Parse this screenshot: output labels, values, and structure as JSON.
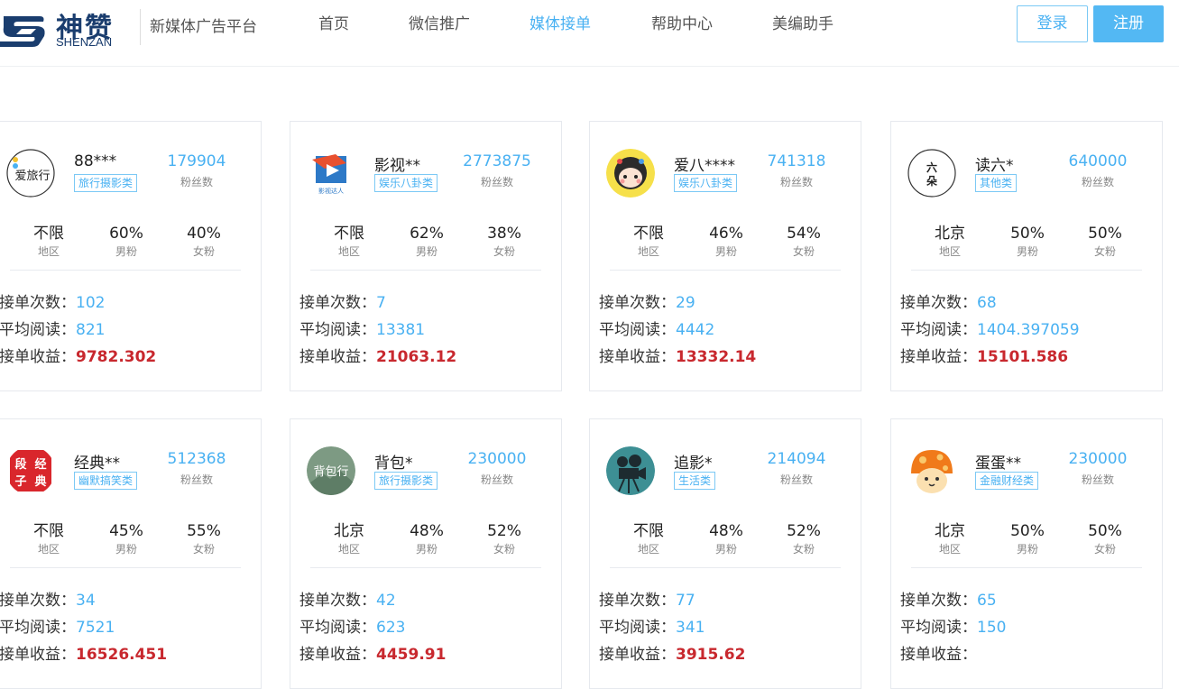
{
  "header": {
    "logo_cn": "神赞",
    "logo_en": "SHENZAN",
    "platform_name": "新媒体广告平台",
    "nav": [
      "首页",
      "微信推广",
      "媒体接单",
      "帮助中心",
      "美编助手"
    ],
    "active_nav": "媒体接单",
    "login_label": "登录",
    "register_label": "注册"
  },
  "labels": {
    "fans": "粉丝数",
    "region": "地区",
    "male": "男粉",
    "female": "女粉",
    "orders": "接单次数：",
    "avg_read": "平均阅读：",
    "income": "接单收益："
  },
  "colors": {
    "accent": "#49b1f2",
    "income_red": "#c8282e",
    "brand_navy": "#1a3d6e"
  },
  "cards": [
    {
      "name": "88***",
      "category": "旅行摄影类",
      "fans": "179904",
      "region": "不限",
      "male": "60%",
      "female": "40%",
      "orders": "102",
      "avg_read": "821",
      "income": "9782.302",
      "avatar_icon": "travel-logo-icon",
      "avatar_text": "爱旅行"
    },
    {
      "name": "影视**",
      "category": "娱乐八卦类",
      "fans": "2773875",
      "region": "不限",
      "male": "62%",
      "female": "38%",
      "orders": "7",
      "avg_read": "13381",
      "income": "21063.12",
      "avatar_icon": "play-logo-icon",
      "avatar_text": "影视达人"
    },
    {
      "name": "爱八****",
      "category": "娱乐八卦类",
      "fans": "741318",
      "region": "不限",
      "male": "46%",
      "female": "54%",
      "orders": "29",
      "avg_read": "4442",
      "income": "13332.14",
      "avatar_icon": "cartoon-girl-icon",
      "avatar_text": ""
    },
    {
      "name": "读六*",
      "category": "其他类",
      "fans": "640000",
      "region": "北京",
      "male": "50%",
      "female": "50%",
      "orders": "68",
      "avg_read": "1404.397059",
      "income": "15101.586",
      "avatar_icon": "seal-logo-icon",
      "avatar_text": "六朵"
    },
    {
      "name": "经典**",
      "category": "幽默搞笑类",
      "fans": "512368",
      "region": "不限",
      "male": "45%",
      "female": "55%",
      "orders": "34",
      "avg_read": "7521",
      "income": "16526.451",
      "avatar_icon": "red-seal-icon",
      "avatar_text": "段子经典"
    },
    {
      "name": "背包*",
      "category": "旅行摄影类",
      "fans": "230000",
      "region": "北京",
      "male": "48%",
      "female": "52%",
      "orders": "42",
      "avg_read": "623",
      "income": "4459.91",
      "avatar_icon": "backpack-logo-icon",
      "avatar_text": "背包行"
    },
    {
      "name": "追影*",
      "category": "生活类",
      "fans": "214094",
      "region": "不限",
      "male": "48%",
      "female": "52%",
      "orders": "77",
      "avg_read": "341",
      "income": "3915.62",
      "avatar_icon": "film-camera-icon",
      "avatar_text": ""
    },
    {
      "name": "蛋蛋**",
      "category": "金融财经类",
      "fans": "230000",
      "region": "北京",
      "male": "50%",
      "female": "50%",
      "orders": "65",
      "avg_read": "150",
      "income": "",
      "avatar_icon": "mushroom-icon",
      "avatar_text": ""
    }
  ]
}
